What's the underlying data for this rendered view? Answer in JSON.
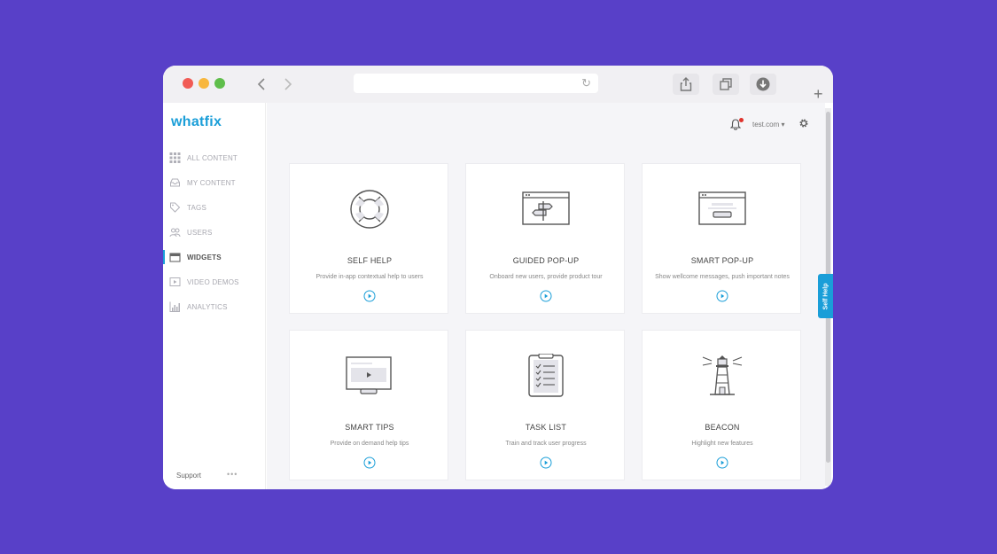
{
  "app": {
    "logo_text": "whatfix",
    "account_label": "test.com",
    "account_caret": "▾"
  },
  "sidebar": {
    "items": [
      {
        "label": "ALL CONTENT",
        "icon": "grid-icon"
      },
      {
        "label": "MY CONTENT",
        "icon": "inbox-icon"
      },
      {
        "label": "TAGS",
        "icon": "tag-icon"
      },
      {
        "label": "USERS",
        "icon": "users-icon"
      },
      {
        "label": "WIDGETS",
        "icon": "widget-icon",
        "active": true
      },
      {
        "label": "VIDEO DEMOS",
        "icon": "video-icon"
      },
      {
        "label": "ANALYTICS",
        "icon": "chart-icon"
      }
    ],
    "support_label": "Support",
    "support_dots": "•••"
  },
  "widgets": [
    {
      "title": "SELF HELP",
      "description": "Provide in-app contextual help to users",
      "icon": "lifebuoy-icon"
    },
    {
      "title": "GUIDED POP-UP",
      "description": "Onboard new users, provide product tour",
      "icon": "signpost-window-icon"
    },
    {
      "title": "SMART POP-UP",
      "description": "Show wellcome messages, push important notes",
      "icon": "popup-window-icon"
    },
    {
      "title": "SMART TIPS",
      "description": "Provide on demand help tips",
      "icon": "video-screen-icon"
    },
    {
      "title": "TASK LIST",
      "description": "Train and track user progress",
      "icon": "clipboard-checklist-icon"
    },
    {
      "title": "BEACON",
      "description": "Highlight new features",
      "icon": "lighthouse-icon"
    }
  ],
  "self_help_tab": "Self Help",
  "colors": {
    "background": "#5840c8",
    "brand": "#1a9ed8",
    "notification": "#e0322c"
  }
}
